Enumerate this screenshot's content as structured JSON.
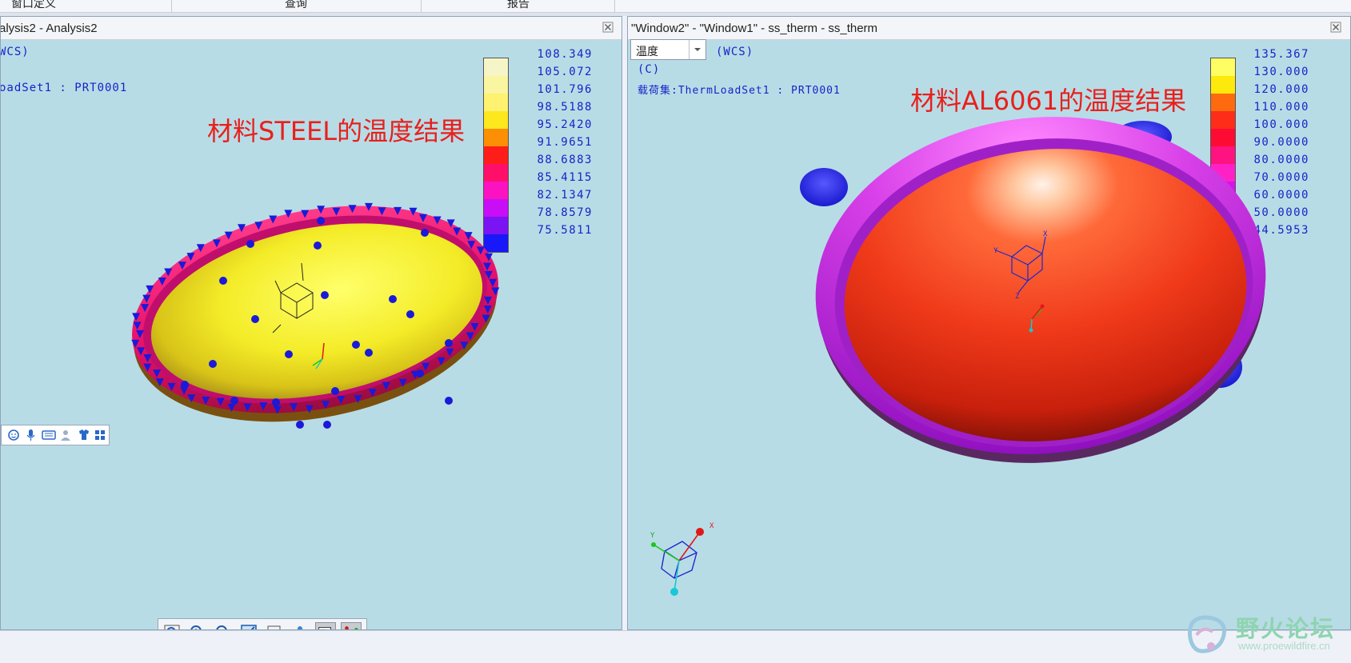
{
  "menubar": {
    "items": [
      "窗口定义",
      "查询",
      "报告"
    ]
  },
  "left_panel": {
    "title": "alysis2 - Analysis2",
    "csys_label": "WCS)",
    "loadset_label": "oadSet1  :   PRT0001",
    "annotation": "材料STEEL的温度结果",
    "legend": {
      "colors": [
        "#f6f5c8",
        "#f9f5a0",
        "#fef270",
        "#fde81e",
        "#fc8f06",
        "#ff1d1a",
        "#ff0e6a",
        "#fb12c0",
        "#c80ef6",
        "#7a14f2",
        "#1818f8"
      ],
      "values": [
        "108.349",
        "105.072",
        "101.796",
        "98.5188",
        "95.2420",
        "91.9651",
        "88.6883",
        "85.4115",
        "82.1347",
        "78.8579",
        "75.5811"
      ]
    }
  },
  "right_panel": {
    "title": "\"Window2\" - \"Window1\" - ss_therm - ss_therm",
    "dropdown_value": "温度",
    "csys_label": "(WCS)",
    "unit_label": "(C)",
    "loadset_label": "载荷集:ThermLoadSet1  :   PRT0001",
    "annotation": "材料AL6061的温度结果",
    "legend": {
      "colors": [
        "#fefe62",
        "#fee90c",
        "#fe6a0e",
        "#fe2d1a",
        "#fe0b34",
        "#fe1380",
        "#fe22c6",
        "#d812ee",
        "#6622f8",
        "#1e18fe"
      ],
      "values": [
        "135.367",
        "130.000",
        "120.000",
        "110.000",
        "100.000",
        "90.0000",
        "80.0000",
        "70.0000",
        "60.0000",
        "50.0000",
        "44.5953"
      ]
    }
  },
  "watermark": {
    "name": "野火论坛",
    "url": "www.proewildfire.cn"
  }
}
